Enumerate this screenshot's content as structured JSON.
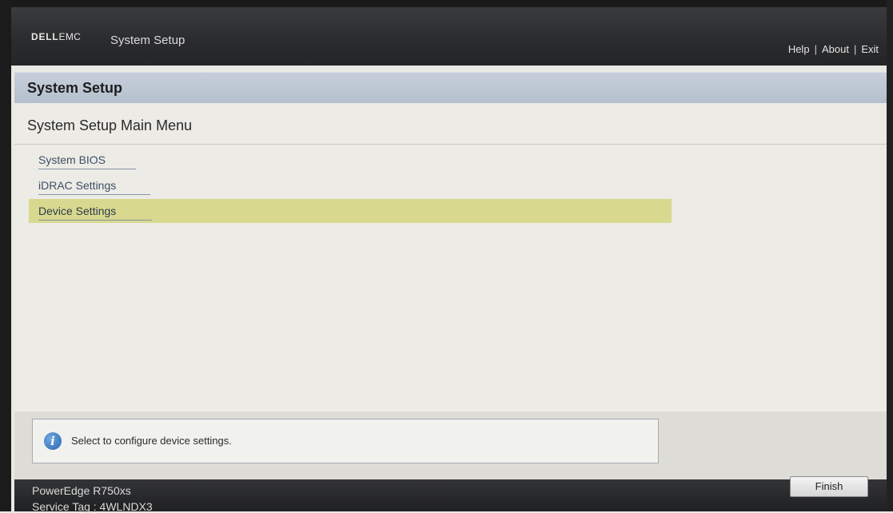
{
  "header": {
    "brand_dell": "DELL",
    "brand_emc": "EMC",
    "app_title": "System Setup",
    "links": {
      "help": "Help",
      "about": "About",
      "exit": "Exit",
      "separator": "|"
    }
  },
  "page": {
    "title": "System Setup"
  },
  "menu": {
    "title": "System Setup Main Menu",
    "items": [
      {
        "label": "System BIOS",
        "selected": false
      },
      {
        "label": "iDRAC Settings",
        "selected": false
      },
      {
        "label": "Device Settings",
        "selected": true
      }
    ],
    "selection_color": "#d8d98f"
  },
  "help": {
    "icon": "info-icon",
    "text": "Select to configure device settings."
  },
  "footer": {
    "model": "PowerEdge R750xs",
    "service_tag": "Service Tag : 4WLNDX3",
    "finish_label": "Finish"
  }
}
